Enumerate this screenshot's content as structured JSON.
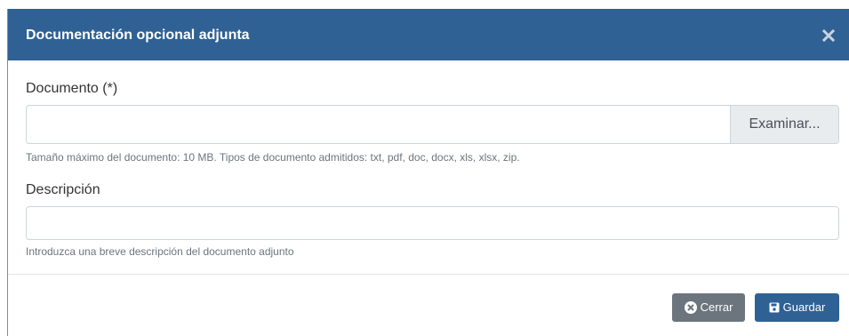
{
  "modal": {
    "title": "Documentación opcional adjunta",
    "close_icon": "times-icon"
  },
  "document_field": {
    "label": "Documento (*)",
    "value": "",
    "browse_label": "Examinar...",
    "help": "Tamaño máximo del documento: 10 MB. Tipos de documento admitidos: txt, pdf, doc, docx, xls, xlsx, zip."
  },
  "description_field": {
    "label": "Descripción",
    "value": "",
    "help": "Introduzca una breve descripción del documento adjunto"
  },
  "footer": {
    "close_label": "Cerrar",
    "close_icon": "times-circle-icon",
    "save_label": "Guardar",
    "save_icon": "save-icon"
  },
  "colors": {
    "header": "#2f6194",
    "primary": "#2f6194",
    "secondary": "#6c757d"
  }
}
